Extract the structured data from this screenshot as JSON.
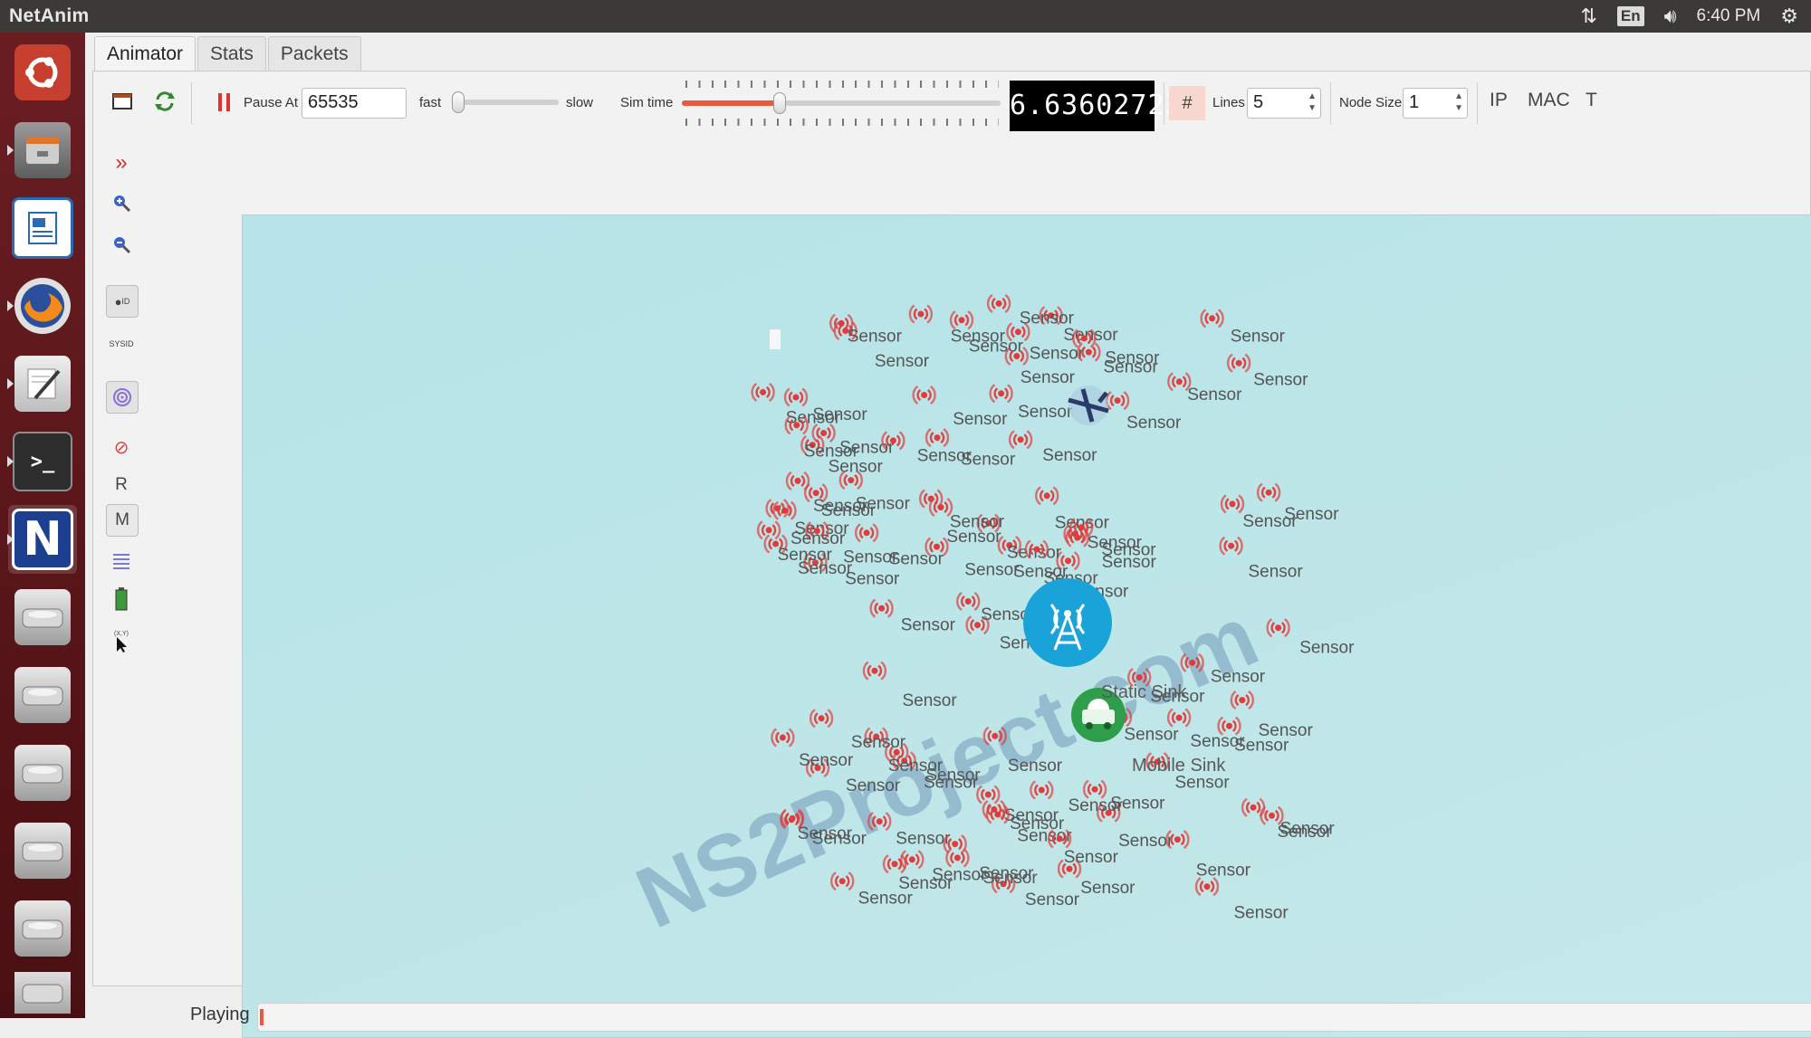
{
  "window": {
    "title": "NetAnim"
  },
  "system_tray": {
    "language": "En",
    "time": "6:40 PM"
  },
  "tabs": [
    "Animator",
    "Stats",
    "Packets"
  ],
  "toolbar": {
    "pause_at_label": "Pause At",
    "pause_at_value": "65535",
    "fast_label": "fast",
    "slow_label": "slow",
    "sim_time_label": "Sim time",
    "sim_time_display": "6.63602723",
    "lines_label": "Lines",
    "lines_value": "5",
    "node_size_label": "Node Size",
    "node_size_value": "1",
    "ip_label": "IP",
    "mac_label": "MAC",
    "t_label": "T",
    "speed_slider_fraction": 0.0,
    "sim_time_slider_fraction": 0.3
  },
  "side_toolbar": {
    "r_label": "R",
    "m_label": "M",
    "sysid_label": "SYSID"
  },
  "scene": {
    "sensor_label": "Sensor",
    "sensor_count": 88,
    "static_sink_label": "Static Sink",
    "mobile_sink_label": "Mobile Sink",
    "watermark": "NS2Project.com"
  },
  "status": {
    "text": "Playing",
    "progress_fraction": 0.002
  },
  "colors": {
    "scene_bg": "#bfe6e8",
    "sensor_icon": "#e23b3b",
    "sink_blue": "#1aa3d8",
    "sink_green": "#2f9e4a",
    "accent": "#e8593e"
  }
}
